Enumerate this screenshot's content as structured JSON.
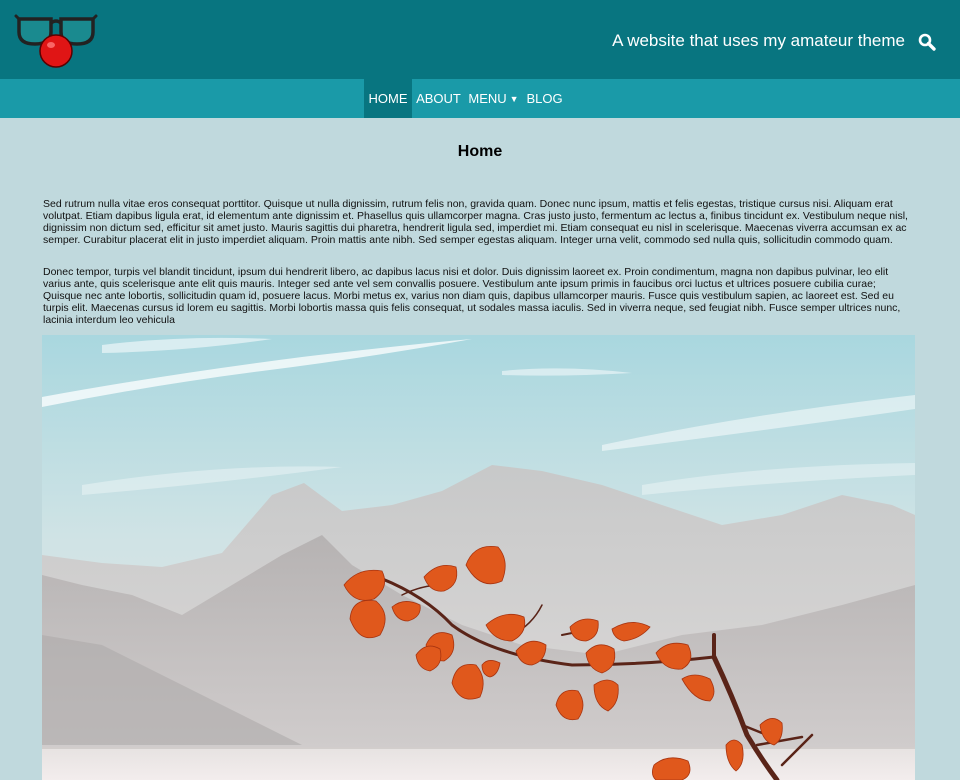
{
  "header": {
    "tagline": "A website that uses my amateur theme",
    "logo_icon": "clown-glasses-nose-icon",
    "search_icon": "search-icon",
    "colors": {
      "header_bg": "#087580",
      "nav_bg": "#1a9aa8",
      "page_bg": "#c0d9dd"
    }
  },
  "nav": {
    "home": "HOME",
    "about": "ABOUT",
    "menu": "MENU",
    "menu_caret": "▼",
    "blog": "BLOG"
  },
  "page": {
    "title": "Home",
    "paragraph_1": "Sed rutrum nulla vitae eros consequat porttitor. Quisque ut nulla dignissim, rutrum felis non, gravida quam. Donec nunc ipsum, mattis et felis egestas, tristique cursus nisi. Aliquam erat volutpat. Etiam dapibus ligula erat, id elementum ante dignissim et. Phasellus quis ullamcorper magna. Cras justo justo, fermentum ac lectus a, finibus tincidunt ex. Vestibulum neque nisl, dignissim non dictum sed, efficitur sit amet justo. Mauris sagittis dui pharetra, hendrerit ligula sed, imperdiet mi. Etiam consequat eu nisl in scelerisque. Maecenas viverra accumsan ex ac semper. Curabitur placerat elit in justo imperdiet aliquam. Proin mattis ante nibh. Sed semper egestas aliquam. Integer urna velit, commodo sed nulla quis, sollicitudin commodo quam.",
    "paragraph_2": "Donec tempor, turpis vel blandit tincidunt, ipsum dui hendrerit libero, ac dapibus lacus nisi et dolor. Duis dignissim laoreet ex. Proin condimentum, magna non dapibus pulvinar, leo elit varius ante, quis scelerisque ante elit quis mauris. Integer sed ante vel sem convallis posuere. Vestibulum ante ipsum primis in faucibus orci luctus et ultrices posuere cubilia curae; Quisque nec ante lobortis, sollicitudin quam id, posuere lacus. Morbi metus ex, varius non diam quis, dapibus ullamcorper mauris. Fusce quis vestibulum sapien, ac laoreet est. Sed eu turpis elit. Maecenas cursus id lorem eu sagittis. Morbi lobortis massa quis felis consequat, ut sodales massa iaculis. Sed in viverra neque, sed feugiat nibh. Fusce semper ultrices nunc, lacinia interdum leo vehicula"
  }
}
